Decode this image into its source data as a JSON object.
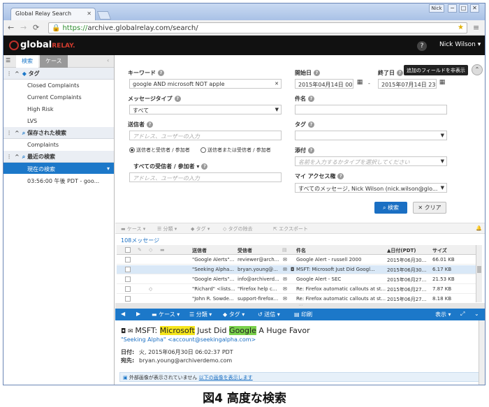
{
  "browser": {
    "tab_title": "Global Relay Search",
    "user_chip": "Nick",
    "url_https": "https://",
    "url_rest": "archive.globalrelay.com/search/",
    "min_glyph": "−",
    "max_glyph": "□",
    "close_glyph": "✕"
  },
  "brand": {
    "logo_main": "global",
    "logo_sub": "RELAY.",
    "help": "?",
    "user": "Nick Wilson ▾"
  },
  "sidebar": {
    "tab_search": "検索",
    "tab_case": "ケース",
    "sections": [
      {
        "title": "タグ",
        "items": [
          "Closed Complaints",
          "Current Complaints",
          "High Risk",
          "LVS"
        ]
      },
      {
        "title": "保存された検索",
        "items": [
          "Complaints"
        ]
      },
      {
        "title": "最近の検索",
        "items": [
          "現在の検索",
          "03:56:00 午後 PDT - goo..."
        ]
      }
    ]
  },
  "search": {
    "keyword_label": "キーワード",
    "keyword_value": "google AND microsoft NOT apple",
    "start_label": "開始日",
    "start_value": "2015年04月14日 00:0",
    "end_label": "終了日",
    "end_value": "2015年07月14日 23",
    "tooltip": "追加のフィールドを非表示",
    "msgtype_label": "メッセージタイプ",
    "msgtype_value": "すべて",
    "subject_label": "件名",
    "sender_label": "送信者",
    "sender_placeholder": "アドレス、ユーザーの入力",
    "tag_label": "タグ",
    "radio1": "送信者と受信者 / 参加者",
    "radio2": "送信者または受信者 / 参加者",
    "attach_label": "添付",
    "attach_placeholder": "名前を入力するかタイプを選択してください",
    "recipients_label": "すべての受信者 / 参加者",
    "recipients_placeholder": "アドレス、ユーザーの入力",
    "access_label": "マイ アクセス権",
    "access_value": "すべてのメッセージ, Nick Wilson (nick.wilson@glo...",
    "search_button": "検索",
    "clear_button": "クリア"
  },
  "toolbar": {
    "case": "ケース ▾",
    "classify": "分類 ▾",
    "tag": "タグ ▾",
    "remove_tag": "タグの除去",
    "export": "エクスポート"
  },
  "results": {
    "count": "108メッセージ",
    "headers": {
      "sender": "送信者",
      "recipient": "受信者",
      "subject": "件名",
      "date": "▲日付(PDT)",
      "size": "サイズ"
    },
    "rows": [
      {
        "sender": "\"Google Alerts\"...",
        "recipient": "reviewer@arch...",
        "subject": "Google Alert - russell 2000",
        "date": "2015年06月30...",
        "size": "66.01 KB"
      },
      {
        "sender": "\"Seeking Alpha...",
        "recipient": "bryan.young@...",
        "subject": "MSFT: Microsoft Just Did Googl...",
        "date": "2015年06月30...",
        "size": "6.17 KB"
      },
      {
        "sender": "\"Google Alerts\"...",
        "recipient": "info@archiverd...",
        "subject": "Google Alert - SEC",
        "date": "2015年06月27...",
        "size": "21.53 KB"
      },
      {
        "sender": "\"Richard\" <lists...",
        "recipient": "\"Firefox help c...",
        "subject": "Re: Firefox automatic callouts at st...",
        "date": "2015年06月27...",
        "size": "7.87 KB"
      },
      {
        "sender": "\"John R. Sowde...",
        "recipient": "support-firefox...",
        "subject": "Re: Firefox automatic callouts at st...",
        "date": "2015年06月27...",
        "size": "8.18 KB"
      }
    ]
  },
  "preview": {
    "case": "ケース ▾",
    "classify": "分類 ▾",
    "tag": "タグ ▾",
    "reply": "送信",
    "print": "印刷",
    "display": "表示 ▾",
    "subject_prefix": "MSFT: ",
    "subject_hl1": "Microsoft",
    "subject_mid": " Just Did ",
    "subject_hl2": "Google",
    "subject_suffix": " A Huge Favor",
    "from": "\"Seeking Alpha\" <account@seekingalpha.com>",
    "date_label": "日付:",
    "date_value": "火, 2015年06月30日 06:02:37 PDT",
    "to_label": "宛先:",
    "to_value": "bryan.young@archiverdemo.com",
    "image_note": "外部画像が表示されていません",
    "image_link": "以下の画像を表示します"
  },
  "caption": "図4 高度な検索"
}
